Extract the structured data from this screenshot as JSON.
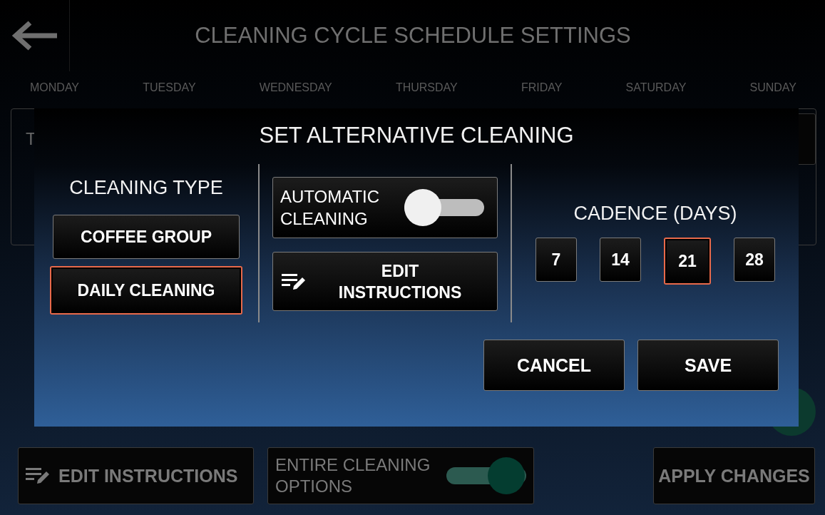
{
  "header": {
    "title": "CLEANING CYCLE SCHEDULE SETTINGS"
  },
  "days": [
    "MONDAY",
    "TUESDAY",
    "WEDNESDAY",
    "THURSDAY",
    "FRIDAY",
    "SATURDAY",
    "SUNDAY"
  ],
  "schedule_card": {
    "text": "T"
  },
  "dialog": {
    "title": "SET ALTERNATIVE CLEANING",
    "cleaning_type": {
      "label": "CLEANING TYPE",
      "options": [
        {
          "label": "COFFEE GROUP",
          "selected": false
        },
        {
          "label": "DAILY CLEANING",
          "selected": true
        }
      ]
    },
    "automatic_cleaning": {
      "label": "AUTOMATIC CLEANING",
      "on": false
    },
    "edit_instructions": {
      "label": "EDIT INSTRUCTIONS"
    },
    "cadence": {
      "label": "CADENCE (DAYS)",
      "options": [
        {
          "label": "7",
          "selected": false
        },
        {
          "label": "14",
          "selected": false
        },
        {
          "label": "21",
          "selected": true
        },
        {
          "label": "28",
          "selected": false
        }
      ]
    },
    "buttons": [
      {
        "label": "CANCEL"
      },
      {
        "label": "SAVE"
      }
    ]
  },
  "bottom_bar": {
    "edit_instructions": "EDIT INSTRUCTIONS",
    "entire_cleaning_options": {
      "label": "ENTIRE CLEANING OPTIONS",
      "on": true
    },
    "apply_changes": "APPLY CHANGES"
  }
}
